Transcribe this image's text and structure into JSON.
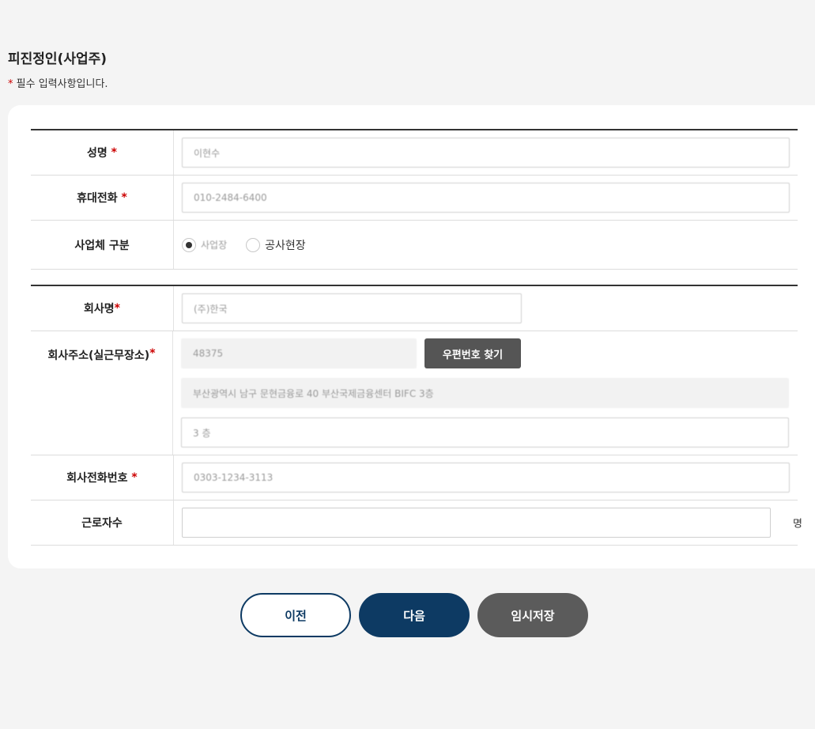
{
  "page": {
    "title": "피진정인(사업주)",
    "required_star": "*",
    "required_note": "필수 입력사항입니다."
  },
  "section1": {
    "name": {
      "label": "성명",
      "star": "*",
      "value": "이현수"
    },
    "phone": {
      "label": "휴대전화",
      "star": "*",
      "value": "010-2484-6400"
    },
    "business_type": {
      "label": "사업체 구분",
      "options": [
        {
          "label": "사업장",
          "selected": true
        },
        {
          "label": "공사현장",
          "selected": false
        }
      ]
    }
  },
  "section2": {
    "company_name": {
      "label": "회사명",
      "star": "*",
      "value": "(주)한국"
    },
    "company_address": {
      "label": "회사주소(실근무장소)",
      "star": "*",
      "zip_value": "48375",
      "zip_button": "우편번호 찾기",
      "address_value": "부산광역시 남구 문현금융로 40 부산국제금융센터 BIFC 3층",
      "detail_value": "3 층"
    },
    "company_phone": {
      "label": "회사전화번호",
      "star": "*",
      "value": "0303-1234-3113"
    },
    "employees": {
      "label": "근로자수",
      "value": "",
      "unit": "명"
    }
  },
  "buttons": {
    "prev": "이전",
    "next": "다음",
    "save": "임시저장"
  },
  "colors": {
    "accent": "#0d3a63",
    "required": "#cc0000",
    "secondary_button": "#5b5b5b"
  }
}
